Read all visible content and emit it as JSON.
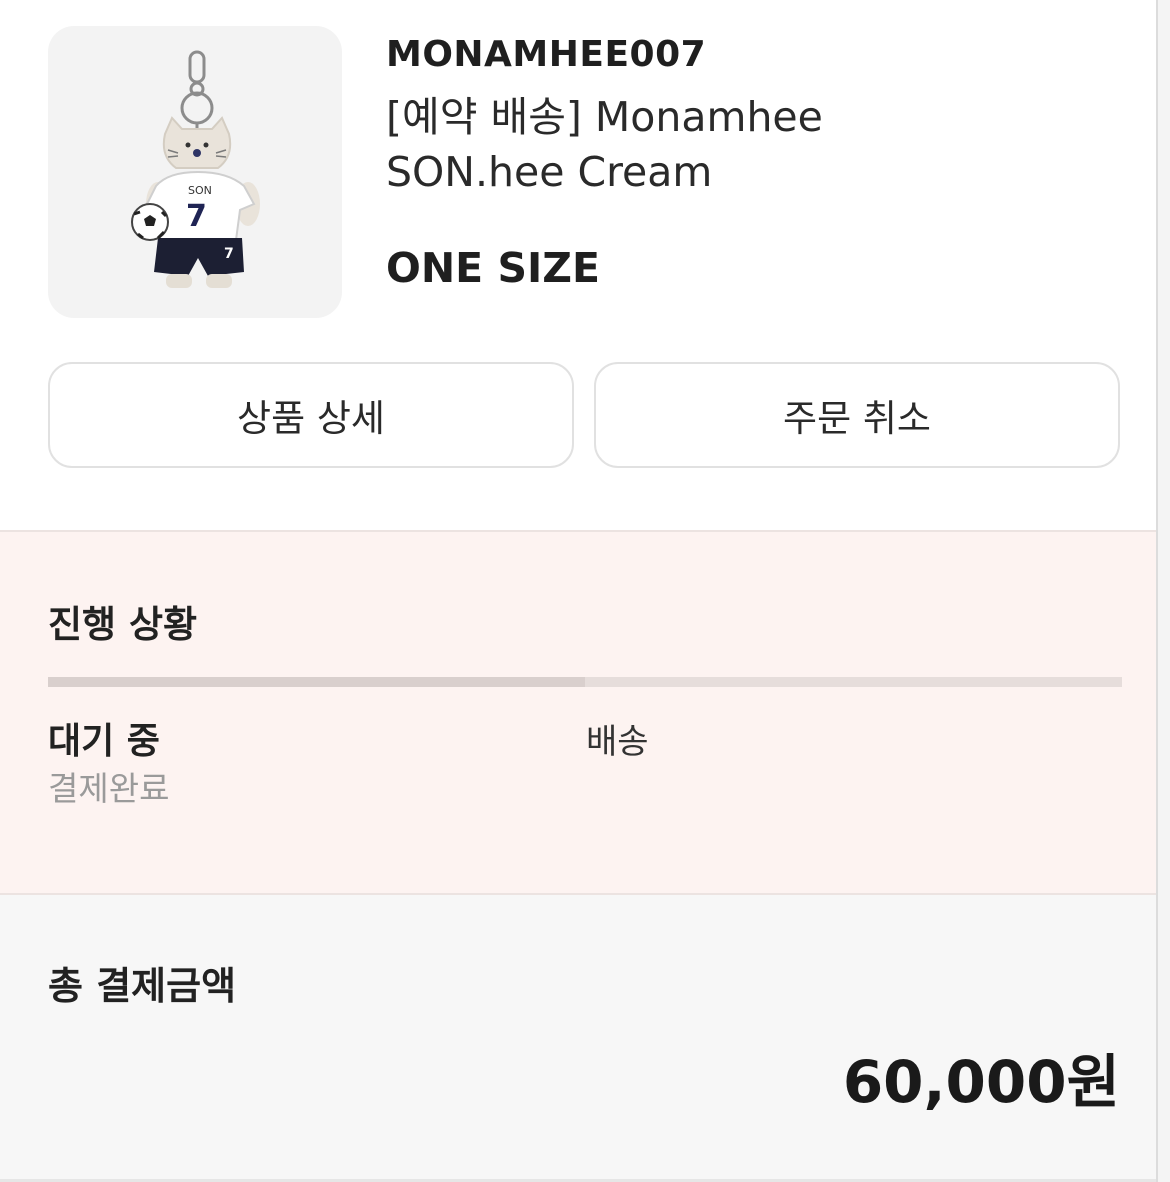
{
  "product": {
    "brand": "MONAMHEE007",
    "name": "[예약 배송] Monamhee SON.hee Cream",
    "size": "ONE SIZE",
    "image_jersey_text": "SON",
    "image_jersey_number": "7",
    "image_shorts_number": "7"
  },
  "actions": {
    "detail_label": "상품 상세",
    "cancel_label": "주문 취소"
  },
  "status": {
    "title": "진행 상황",
    "progress_fraction": 0.5,
    "current_step": "대기 중",
    "current_step_sub": "결제완료",
    "next_step": "배송"
  },
  "payment": {
    "title": "총 결제금액",
    "amount": "60,000원"
  },
  "colors": {
    "status_bg": "#fdf3f1",
    "payment_bg": "#f7f7f7",
    "thumb_bg": "#f3f3f3"
  }
}
